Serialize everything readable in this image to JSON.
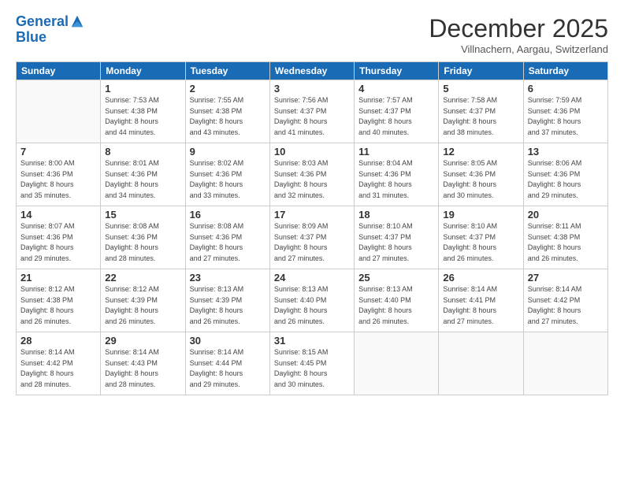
{
  "header": {
    "logo_line1": "General",
    "logo_line2": "Blue",
    "month_title": "December 2025",
    "subtitle": "Villnachern, Aargau, Switzerland"
  },
  "weekdays": [
    "Sunday",
    "Monday",
    "Tuesday",
    "Wednesday",
    "Thursday",
    "Friday",
    "Saturday"
  ],
  "weeks": [
    [
      {
        "day": "",
        "info": ""
      },
      {
        "day": "1",
        "info": "Sunrise: 7:53 AM\nSunset: 4:38 PM\nDaylight: 8 hours\nand 44 minutes."
      },
      {
        "day": "2",
        "info": "Sunrise: 7:55 AM\nSunset: 4:38 PM\nDaylight: 8 hours\nand 43 minutes."
      },
      {
        "day": "3",
        "info": "Sunrise: 7:56 AM\nSunset: 4:37 PM\nDaylight: 8 hours\nand 41 minutes."
      },
      {
        "day": "4",
        "info": "Sunrise: 7:57 AM\nSunset: 4:37 PM\nDaylight: 8 hours\nand 40 minutes."
      },
      {
        "day": "5",
        "info": "Sunrise: 7:58 AM\nSunset: 4:37 PM\nDaylight: 8 hours\nand 38 minutes."
      },
      {
        "day": "6",
        "info": "Sunrise: 7:59 AM\nSunset: 4:36 PM\nDaylight: 8 hours\nand 37 minutes."
      }
    ],
    [
      {
        "day": "7",
        "info": "Sunrise: 8:00 AM\nSunset: 4:36 PM\nDaylight: 8 hours\nand 35 minutes."
      },
      {
        "day": "8",
        "info": "Sunrise: 8:01 AM\nSunset: 4:36 PM\nDaylight: 8 hours\nand 34 minutes."
      },
      {
        "day": "9",
        "info": "Sunrise: 8:02 AM\nSunset: 4:36 PM\nDaylight: 8 hours\nand 33 minutes."
      },
      {
        "day": "10",
        "info": "Sunrise: 8:03 AM\nSunset: 4:36 PM\nDaylight: 8 hours\nand 32 minutes."
      },
      {
        "day": "11",
        "info": "Sunrise: 8:04 AM\nSunset: 4:36 PM\nDaylight: 8 hours\nand 31 minutes."
      },
      {
        "day": "12",
        "info": "Sunrise: 8:05 AM\nSunset: 4:36 PM\nDaylight: 8 hours\nand 30 minutes."
      },
      {
        "day": "13",
        "info": "Sunrise: 8:06 AM\nSunset: 4:36 PM\nDaylight: 8 hours\nand 29 minutes."
      }
    ],
    [
      {
        "day": "14",
        "info": "Sunrise: 8:07 AM\nSunset: 4:36 PM\nDaylight: 8 hours\nand 29 minutes."
      },
      {
        "day": "15",
        "info": "Sunrise: 8:08 AM\nSunset: 4:36 PM\nDaylight: 8 hours\nand 28 minutes."
      },
      {
        "day": "16",
        "info": "Sunrise: 8:08 AM\nSunset: 4:36 PM\nDaylight: 8 hours\nand 27 minutes."
      },
      {
        "day": "17",
        "info": "Sunrise: 8:09 AM\nSunset: 4:37 PM\nDaylight: 8 hours\nand 27 minutes."
      },
      {
        "day": "18",
        "info": "Sunrise: 8:10 AM\nSunset: 4:37 PM\nDaylight: 8 hours\nand 27 minutes."
      },
      {
        "day": "19",
        "info": "Sunrise: 8:10 AM\nSunset: 4:37 PM\nDaylight: 8 hours\nand 26 minutes."
      },
      {
        "day": "20",
        "info": "Sunrise: 8:11 AM\nSunset: 4:38 PM\nDaylight: 8 hours\nand 26 minutes."
      }
    ],
    [
      {
        "day": "21",
        "info": "Sunrise: 8:12 AM\nSunset: 4:38 PM\nDaylight: 8 hours\nand 26 minutes."
      },
      {
        "day": "22",
        "info": "Sunrise: 8:12 AM\nSunset: 4:39 PM\nDaylight: 8 hours\nand 26 minutes."
      },
      {
        "day": "23",
        "info": "Sunrise: 8:13 AM\nSunset: 4:39 PM\nDaylight: 8 hours\nand 26 minutes."
      },
      {
        "day": "24",
        "info": "Sunrise: 8:13 AM\nSunset: 4:40 PM\nDaylight: 8 hours\nand 26 minutes."
      },
      {
        "day": "25",
        "info": "Sunrise: 8:13 AM\nSunset: 4:40 PM\nDaylight: 8 hours\nand 26 minutes."
      },
      {
        "day": "26",
        "info": "Sunrise: 8:14 AM\nSunset: 4:41 PM\nDaylight: 8 hours\nand 27 minutes."
      },
      {
        "day": "27",
        "info": "Sunrise: 8:14 AM\nSunset: 4:42 PM\nDaylight: 8 hours\nand 27 minutes."
      }
    ],
    [
      {
        "day": "28",
        "info": "Sunrise: 8:14 AM\nSunset: 4:42 PM\nDaylight: 8 hours\nand 28 minutes."
      },
      {
        "day": "29",
        "info": "Sunrise: 8:14 AM\nSunset: 4:43 PM\nDaylight: 8 hours\nand 28 minutes."
      },
      {
        "day": "30",
        "info": "Sunrise: 8:14 AM\nSunset: 4:44 PM\nDaylight: 8 hours\nand 29 minutes."
      },
      {
        "day": "31",
        "info": "Sunrise: 8:15 AM\nSunset: 4:45 PM\nDaylight: 8 hours\nand 30 minutes."
      },
      {
        "day": "",
        "info": ""
      },
      {
        "day": "",
        "info": ""
      },
      {
        "day": "",
        "info": ""
      }
    ]
  ]
}
